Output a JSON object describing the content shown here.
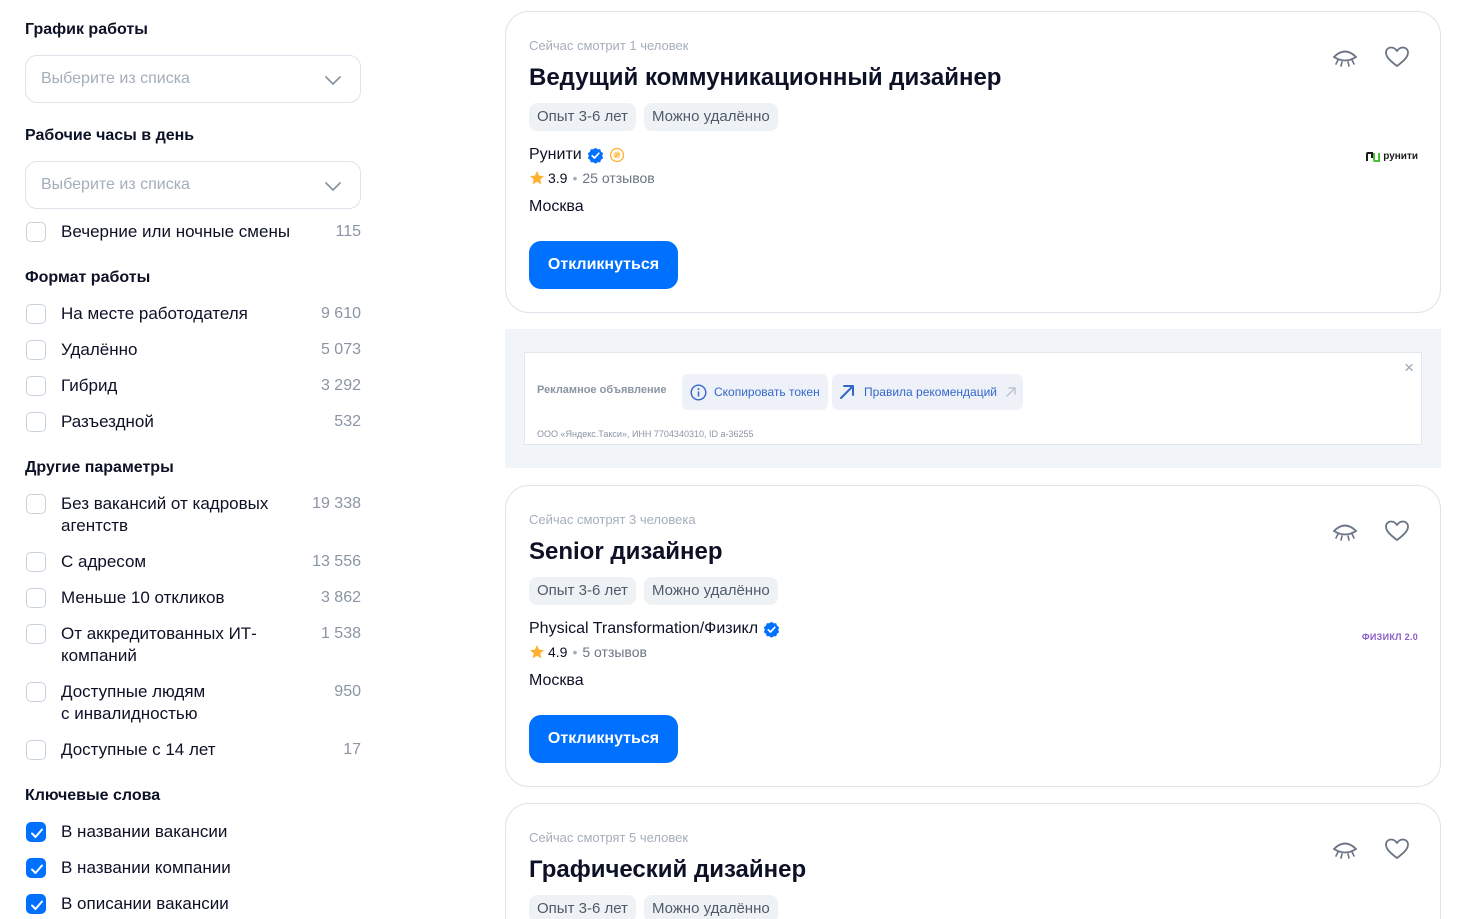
{
  "filters": {
    "schedule": {
      "title": "График работы",
      "placeholder": "Выберите из списка"
    },
    "hours": {
      "title": "Рабочие часы в день",
      "placeholder": "Выберите из списка",
      "options": [
        {
          "label": "Вечерние или ночные смены",
          "count": "115",
          "checked": false
        }
      ]
    },
    "format": {
      "title": "Формат работы",
      "options": [
        {
          "label": "На месте работодателя",
          "count": "9 610",
          "checked": false
        },
        {
          "label": "Удалённо",
          "count": "5 073",
          "checked": false
        },
        {
          "label": "Гибрид",
          "count": "3 292",
          "checked": false
        },
        {
          "label": "Разъездной",
          "count": "532",
          "checked": false
        }
      ]
    },
    "other": {
      "title": "Другие параметры",
      "options": [
        {
          "label_lines": [
            "Без вакансий от кадровых",
            "агентств"
          ],
          "count": "19 338",
          "checked": false
        },
        {
          "label": "С адресом",
          "count": "13 556",
          "checked": false
        },
        {
          "label": "Меньше 10 откликов",
          "count": "3 862",
          "checked": false
        },
        {
          "label_lines": [
            "От аккредитованных ИТ-",
            "компаний"
          ],
          "count": "1 538",
          "checked": false
        },
        {
          "label_lines": [
            "Доступные людям",
            "с инвалидностью"
          ],
          "count": "950",
          "checked": false
        },
        {
          "label": "Доступные с 14 лет",
          "count": "17",
          "checked": false
        }
      ]
    },
    "keywords": {
      "title": "Ключевые слова",
      "options": [
        {
          "label": "В названии вакансии",
          "checked": true
        },
        {
          "label": "В названии компании",
          "checked": true
        },
        {
          "label": "В описании вакансии",
          "checked": true
        }
      ]
    }
  },
  "vacancies": [
    {
      "viewers": "Сейчас смотрит 1 человек",
      "title": "Ведущий коммуникационный дизайнер",
      "tags": [
        "Опыт 3-6 лет",
        "Можно удалённо"
      ],
      "company": "Рунити",
      "rating": "3.9",
      "reviews": "25 отзывов",
      "city": "Москва",
      "apply": "Откликнуться",
      "logo_text": "рунити"
    },
    {
      "viewers": "Сейчас смотрят 3 человека",
      "title": "Senior дизайнер",
      "tags": [
        "Опыт 3-6 лет",
        "Можно удалённо"
      ],
      "company": "Physical Transformation/Физикл",
      "rating": "4.9",
      "reviews": "5 отзывов",
      "city": "Москва",
      "apply": "Откликнуться",
      "logo_text": "ФИЗИКЛ 2.0"
    },
    {
      "viewers": "Сейчас смотрят 5 человек",
      "title": "Графический дизайнер",
      "tags": [
        "Опыт 3-6 лет",
        "Можно удалённо"
      ]
    }
  ],
  "ad": {
    "label": "Рекламное объявление",
    "copy_token": "Скопировать токен",
    "rules": "Правила рекомендаций",
    "legal": "ООО «Яндекс.Такси», ИНН 7704340310, ID a-36255",
    "close": "×"
  },
  "colors": {
    "accent": "#0070ff",
    "verified": "#0070ff",
    "star": "#ffb02e",
    "muted": "#a4aebb"
  }
}
